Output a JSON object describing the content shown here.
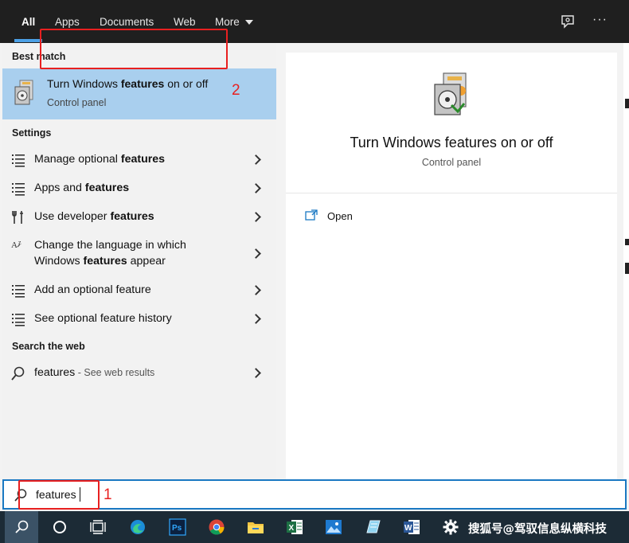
{
  "tabs": [
    {
      "label": "All",
      "active": true
    },
    {
      "label": "Apps"
    },
    {
      "label": "Documents"
    },
    {
      "label": "Web"
    },
    {
      "label": "More"
    }
  ],
  "top_icons": {
    "feedback": "feedback-icon",
    "more": "···"
  },
  "left": {
    "best_match_header": "Best match",
    "best_match": {
      "title_pre": "Turn Windows ",
      "title_bold": "features",
      "title_post": " on or off",
      "subtitle": "Control panel",
      "icon": "windows-features-icon"
    },
    "settings_header": "Settings",
    "settings_items": [
      {
        "pre": "Manage optional ",
        "bold": "features",
        "post": "",
        "icon": "list-settings-icon"
      },
      {
        "pre": "Apps and ",
        "bold": "features",
        "post": "",
        "icon": "list-settings-icon"
      },
      {
        "pre": "Use developer ",
        "bold": "features",
        "post": "",
        "icon": "developer-tools-icon"
      },
      {
        "line1": "Change the language in which",
        "pre2": "Windows ",
        "bold2": "features",
        "post2": " appear",
        "icon": "language-icon"
      },
      {
        "pre": "Add an optional feature",
        "bold": "",
        "post": "",
        "icon": "list-settings-icon"
      },
      {
        "pre": "See optional feature history",
        "bold": "",
        "post": "",
        "icon": "list-settings-icon"
      }
    ],
    "web_header": "Search the web",
    "web_item": {
      "query": "features",
      "hint": " - See web results",
      "icon": "search-icon"
    }
  },
  "right": {
    "title": "Turn Windows features on or off",
    "subtitle": "Control panel",
    "action": {
      "label": "Open",
      "icon": "open-icon"
    }
  },
  "search": {
    "value": "features"
  },
  "annotations": {
    "one": "1",
    "two": "2"
  },
  "taskbar": {
    "icons": [
      "search-icon",
      "cortana-icon",
      "task-view-icon",
      "edge-icon",
      "photoshop-icon",
      "chrome-icon",
      "file-explorer-icon",
      "excel-icon",
      "photos-icon",
      "notepad-icon",
      "word-icon",
      "settings-gear-icon"
    ],
    "watermark": "搜狐号@驾驭信息纵横科技"
  },
  "colors": {
    "accent": "#1a78c2",
    "selection": "#a9cfee",
    "annotation": "#e82020"
  }
}
